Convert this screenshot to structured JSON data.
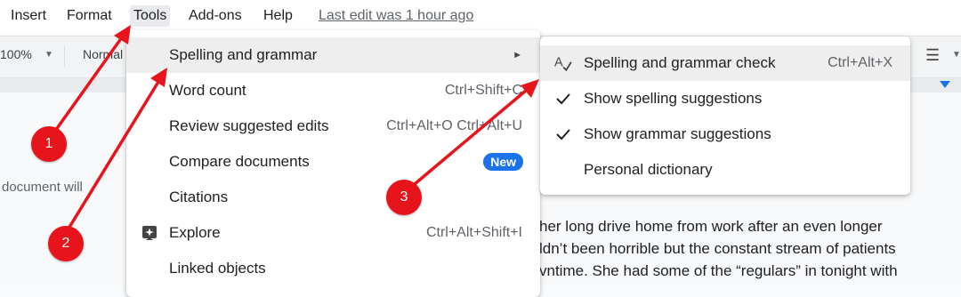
{
  "menubar": {
    "items": [
      "Insert",
      "Format",
      "Tools",
      "Add-ons",
      "Help"
    ],
    "last_edit": "Last edit was 1 hour ago"
  },
  "toolbar": {
    "zoom": "100%",
    "style": "Normal"
  },
  "document": {
    "left_text": "document will",
    "paragraph_lines": [
      "her long drive home from work after an even longer",
      "ldn’t been horrible but the constant stream of patients",
      "vntime. She had some of the “regulars” in tonight with"
    ]
  },
  "tools_menu": {
    "items": [
      {
        "label": "Spelling and grammar",
        "shortcut": "",
        "submenu": true,
        "icon": ""
      },
      {
        "label": "Word count",
        "shortcut": "Ctrl+Shift+C",
        "icon": ""
      },
      {
        "label": "Review suggested edits",
        "shortcut": "Ctrl+Alt+O Ctrl+Alt+U",
        "icon": ""
      },
      {
        "label": "Compare documents",
        "badge": "New",
        "icon": ""
      },
      {
        "label": "Citations",
        "shortcut": "",
        "icon": ""
      },
      {
        "label": "Explore",
        "shortcut": "Ctrl+Alt+Shift+I",
        "icon": "explore-icon"
      },
      {
        "label": "Linked objects",
        "shortcut": "",
        "icon": ""
      }
    ]
  },
  "spelling_submenu": {
    "items": [
      {
        "label": "Spelling and grammar check",
        "shortcut": "Ctrl+Alt+X",
        "icon": "spellcheck-icon"
      },
      {
        "label": "Show spelling suggestions",
        "checked": true
      },
      {
        "label": "Show grammar suggestions",
        "checked": true
      },
      {
        "label": "Personal dictionary",
        "checked": false
      }
    ]
  },
  "callouts": [
    "1",
    "2",
    "3"
  ],
  "colors": {
    "accent": "#1a73e8",
    "annotation_red": "#e8141c",
    "menu_hover": "#eeeeee"
  }
}
